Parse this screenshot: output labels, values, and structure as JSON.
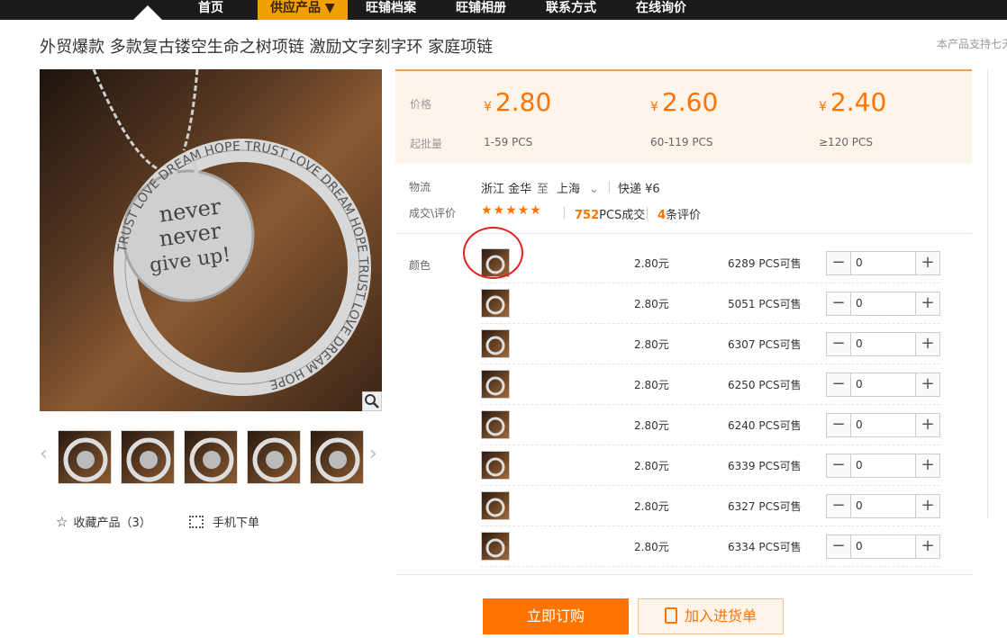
{
  "nav": {
    "items": [
      {
        "label": "首页"
      },
      {
        "label": "供应产品 ▼"
      },
      {
        "label": "旺铺档案"
      },
      {
        "label": "旺铺相册"
      },
      {
        "label": "联系方式"
      },
      {
        "label": "在线询价"
      }
    ],
    "active_color": "#f0a000"
  },
  "product": {
    "title": "外贸爆款 多款复古镂空生命之树项链 激励文字刻字环 家庭项链",
    "support_note": "本产品支持七天",
    "image_text": {
      "pendant": [
        "never",
        "never",
        "give up!"
      ],
      "ring": "TRUST LOVE DREAM HOPE TRUST LOVE DREAM HOPE TRUST LOVE DREAM HOPE"
    }
  },
  "gallery": {
    "prev_icon": "‹",
    "next_icon": "›"
  },
  "actions": {
    "favorite_label": "收藏产品（3）",
    "mobile_label": "手机下单"
  },
  "pricing": {
    "price_label": "价格",
    "moq_label": "起批量",
    "currency": "¥",
    "tiers": [
      {
        "price": "2.80",
        "range": "1-59  PCS"
      },
      {
        "price": "2.60",
        "range": "60-119  PCS"
      },
      {
        "price": "2.40",
        "range": "≥120  PCS"
      }
    ],
    "accent_color": "#ff7300"
  },
  "logistics": {
    "label": "物流",
    "from": "浙江 金华",
    "to_word": "至",
    "to": "上海",
    "express": "快递 ¥6"
  },
  "deals": {
    "label": "成交\\评价",
    "stars": "★★★★★",
    "count": "752",
    "count_unit": "PCS成交",
    "reviews": "4",
    "reviews_unit": "条评价"
  },
  "variants": {
    "label": "颜色",
    "rows": [
      {
        "price": "2.80元",
        "stock": "6289 PCS可售",
        "qty": "0"
      },
      {
        "price": "2.80元",
        "stock": "5051 PCS可售",
        "qty": "0"
      },
      {
        "price": "2.80元",
        "stock": "6307 PCS可售",
        "qty": "0"
      },
      {
        "price": "2.80元",
        "stock": "6250 PCS可售",
        "qty": "0"
      },
      {
        "price": "2.80元",
        "stock": "6240 PCS可售",
        "qty": "0"
      },
      {
        "price": "2.80元",
        "stock": "6339 PCS可售",
        "qty": "0"
      },
      {
        "price": "2.80元",
        "stock": "6327 PCS可售",
        "qty": "0"
      },
      {
        "price": "2.80元",
        "stock": "6334 PCS可售",
        "qty": "0"
      }
    ],
    "minus": "−",
    "plus": "+"
  },
  "buttons": {
    "buy_now": "立即订购",
    "add_to_list": "加入进货单"
  }
}
